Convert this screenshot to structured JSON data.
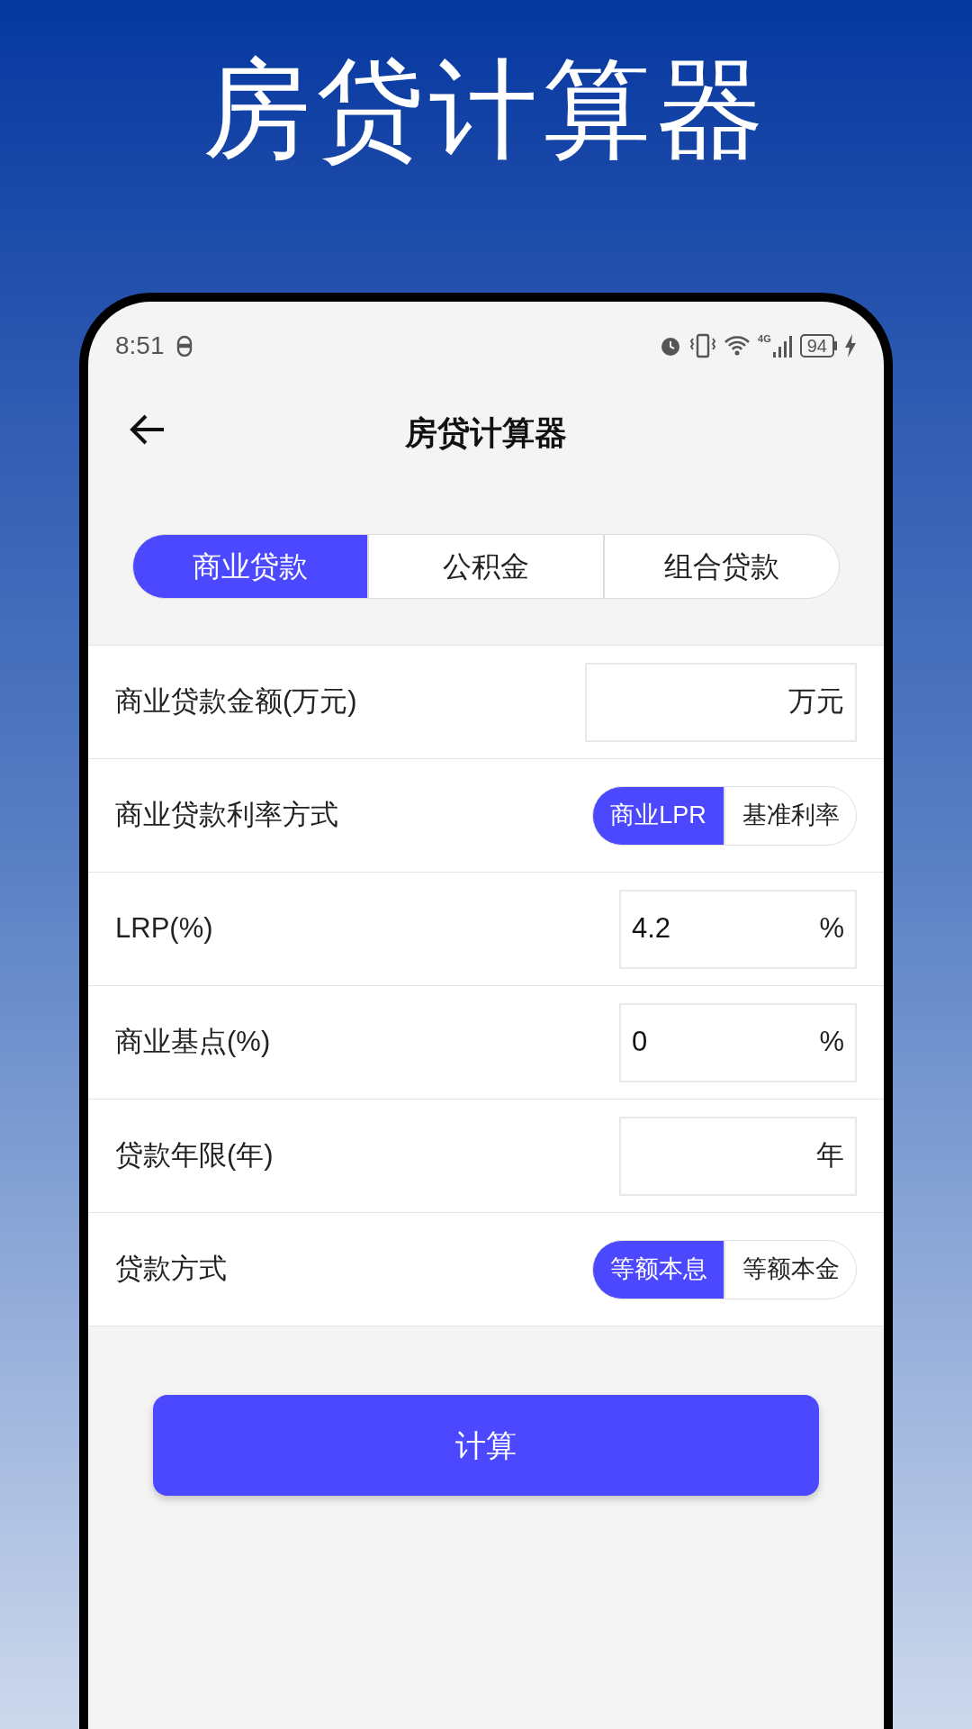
{
  "headline": "房贷计算器",
  "status_bar": {
    "time": "8:51",
    "network": "4G",
    "battery": "94"
  },
  "header": {
    "title": "房贷计算器"
  },
  "tabs": [
    {
      "label": "商业贷款",
      "selected": true
    },
    {
      "label": "公积金",
      "selected": false
    },
    {
      "label": "组合贷款",
      "selected": false
    }
  ],
  "rows": [
    {
      "kind": "input",
      "label": "商业贷款金额(万元)",
      "value": "",
      "unit": "万元"
    },
    {
      "kind": "segmented",
      "label": "商业贷款利率方式",
      "options": [
        {
          "label": "商业LPR",
          "selected": true
        },
        {
          "label": "基准利率",
          "selected": false
        }
      ]
    },
    {
      "kind": "input",
      "label": "LRP(%)",
      "value": "4.2",
      "unit": "%"
    },
    {
      "kind": "input",
      "label": "商业基点(%)",
      "value": "0",
      "unit": "%"
    },
    {
      "kind": "input",
      "label": "贷款年限(年)",
      "value": "",
      "unit": "年"
    },
    {
      "kind": "segmented",
      "label": "贷款方式",
      "options": [
        {
          "label": "等额本息",
          "selected": true
        },
        {
          "label": "等额本金",
          "selected": false
        }
      ]
    }
  ],
  "button": "计算"
}
